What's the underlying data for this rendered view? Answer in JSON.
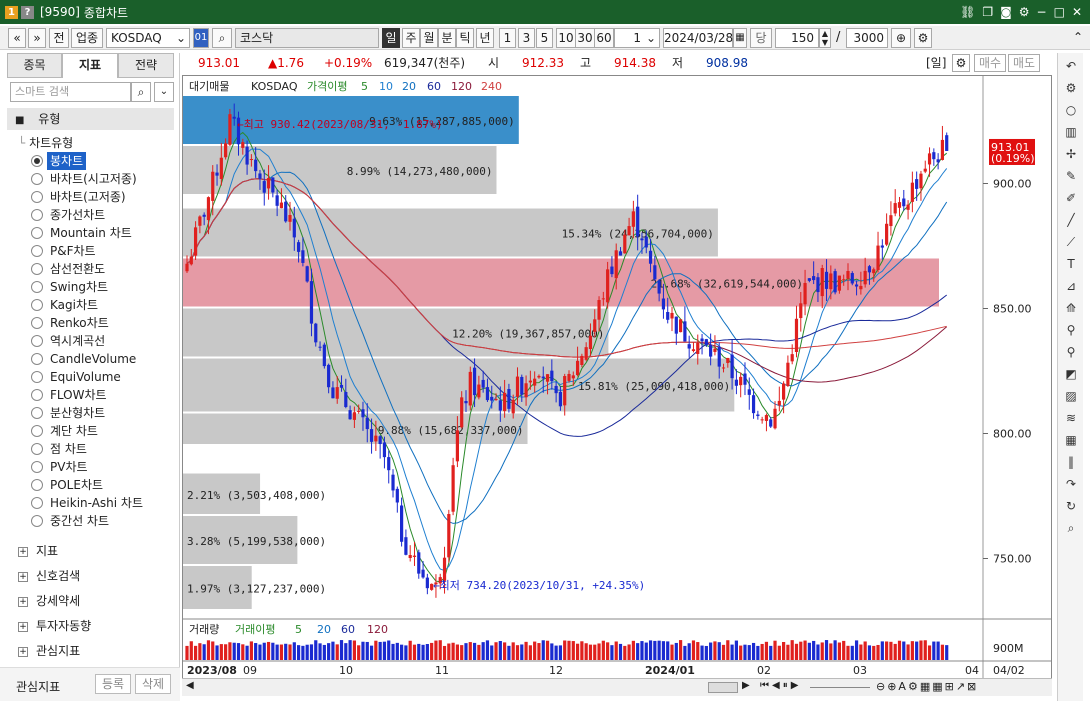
{
  "window": {
    "code": "[9590]",
    "title": "종합차트"
  },
  "toolbar": {
    "market_btn": "전",
    "category_btn": "업종",
    "code_input": "KOSDAQ",
    "name_input": "코스닥",
    "periods": [
      "일",
      "주",
      "월",
      "분",
      "틱",
      "년"
    ],
    "selected_period": "일",
    "minute_opts": [
      "1",
      "3",
      "5",
      "10",
      "30",
      "60"
    ],
    "unit_value": "1",
    "date": "2024/03/28",
    "date_label": "당",
    "count": "150",
    "total": "3000"
  },
  "quote": {
    "price": "913.01",
    "change": "▲1.76",
    "change_pct": "+0.19%",
    "volume": "619,347(천주)",
    "open_label": "시",
    "open": "912.33",
    "high_label": "고",
    "high": "914.38",
    "low_label": "저",
    "low": "908.98",
    "period_tag": "[일]",
    "buy_btn": "매수",
    "sell_btn": "매도"
  },
  "left_panel": {
    "tabs": [
      "종목",
      "지표",
      "전략"
    ],
    "active_tab": "지표",
    "search_placeholder": "스마트 검색",
    "group_label": "유형",
    "tree_root": "차트유형",
    "chart_types": [
      "봉차트",
      "바차트(시고저종)",
      "바차트(고저종)",
      "종가선차트",
      "Mountain 차트",
      "P&F차트",
      "삼선전환도",
      "Swing차트",
      "Kagi차트",
      "Renko차트",
      "역시계곡선",
      "CandleVolume",
      "EquiVolume",
      "FLOW차트",
      "분산형차트",
      "계단 차트",
      "점 차트",
      "PV차트",
      "POLE차트",
      "Heikin-Ashi 차트",
      "중간선 차트"
    ],
    "selected_type": "봉차트",
    "sections": [
      "지표",
      "신호검색",
      "강세약세",
      "투자자동향",
      "관심지표"
    ],
    "footer_label": "관심지표",
    "register_btn": "등록",
    "delete_btn": "삭제"
  },
  "chart_data": {
    "type": "candlestick",
    "legend": {
      "vp": "대기매물",
      "name": "KOSDAQ",
      "ma_label": "가격이평",
      "ma": [
        "5",
        "10",
        "20",
        "60",
        "120",
        "240"
      ]
    },
    "y_ticks": [
      "900.00",
      "850.00",
      "800.00",
      "750.00"
    ],
    "y_tick_values": [
      900,
      850,
      800,
      750
    ],
    "ylim": [
      727,
      935
    ],
    "current_price_tag": "913.01",
    "current_pct_tag": "(0.19%)",
    "high_annotation": "←최고 930.42(2023/08/31, -1.87%)",
    "low_annotation": "←최저 734.20(2023/10/31, +24.35%)",
    "volume_profile": [
      {
        "pct": 9.63,
        "label": "9.63% (15,287,885,000)",
        "range": [
          915,
          935
        ]
      },
      {
        "pct": 8.99,
        "label": "8.99% (14,273,480,000)",
        "range": [
          895,
          915
        ]
      },
      {
        "pct": 15.34,
        "label": "15.34% (24,356,704,000)",
        "range": [
          870,
          890
        ]
      },
      {
        "pct": 21.68,
        "label": "21.68% (32,619,544,000)",
        "range": [
          850,
          870
        ]
      },
      {
        "pct": 12.2,
        "label": "12.20% (19,367,857,000)",
        "range": [
          830,
          850
        ]
      },
      {
        "pct": 15.81,
        "label": "15.81% (25,090,418,000)",
        "range": [
          808,
          830
        ]
      },
      {
        "pct": 9.88,
        "label": "9.88% (15,682,337,000)",
        "range": [
          795,
          808
        ]
      },
      {
        "pct": 2.21,
        "label": "2.21% (3,503,408,000)",
        "range": [
          767,
          784
        ]
      },
      {
        "pct": 3.28,
        "label": "3.28% (5,199,538,000)",
        "range": [
          747,
          767
        ]
      },
      {
        "pct": 1.97,
        "label": "1.97% (3,127,237,000)",
        "range": [
          729,
          747
        ]
      }
    ],
    "x_labels": [
      "2023/08",
      "09",
      "10",
      "11",
      "12",
      "2024/01",
      "02",
      "03",
      "04"
    ],
    "close_keypoints": [
      [
        0,
        868
      ],
      [
        6,
        900
      ],
      [
        10,
        925
      ],
      [
        16,
        905
      ],
      [
        22,
        890
      ],
      [
        26,
        875
      ],
      [
        30,
        840
      ],
      [
        34,
        818
      ],
      [
        38,
        810
      ],
      [
        42,
        800
      ],
      [
        46,
        790
      ],
      [
        50,
        760
      ],
      [
        54,
        745
      ],
      [
        58,
        738
      ],
      [
        60,
        755
      ],
      [
        62,
        790
      ],
      [
        64,
        810
      ],
      [
        66,
        820
      ],
      [
        70,
        815
      ],
      [
        74,
        812
      ],
      [
        78,
        820
      ],
      [
        82,
        828
      ],
      [
        86,
        812
      ],
      [
        90,
        825
      ],
      [
        94,
        840
      ],
      [
        98,
        862
      ],
      [
        102,
        880
      ],
      [
        104,
        886
      ],
      [
        106,
        880
      ],
      [
        108,
        865
      ],
      [
        112,
        848
      ],
      [
        116,
        840
      ],
      [
        120,
        835
      ],
      [
        124,
        830
      ],
      [
        128,
        822
      ],
      [
        132,
        812
      ],
      [
        136,
        806
      ],
      [
        138,
        812
      ],
      [
        140,
        828
      ],
      [
        144,
        858
      ],
      [
        148,
        862
      ],
      [
        152,
        860
      ],
      [
        156,
        862
      ],
      [
        160,
        870
      ],
      [
        164,
        885
      ],
      [
        168,
        895
      ],
      [
        172,
        908
      ],
      [
        176,
        913
      ]
    ],
    "volume": {
      "label": "거래량",
      "ma_label": "거래이평",
      "ma": [
        "5",
        "20",
        "60",
        "120"
      ],
      "axis_label": "900M"
    },
    "end_date_label": "04/02"
  }
}
